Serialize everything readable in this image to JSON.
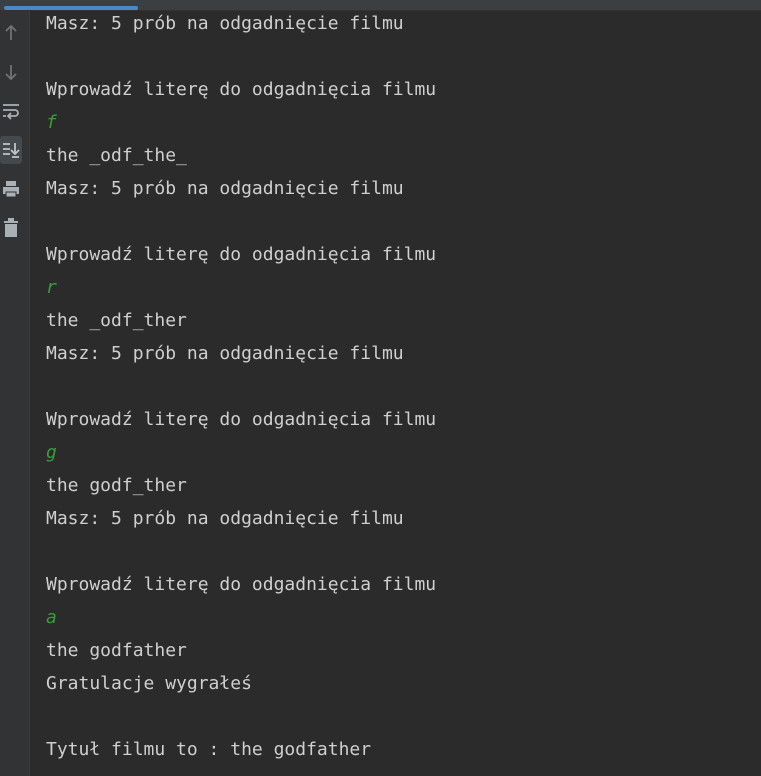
{
  "toolbar": {
    "items": [
      {
        "icon": "arrow-up-icon"
      },
      {
        "icon": "arrow-down-icon"
      },
      {
        "icon": "soft-wrap-icon"
      },
      {
        "icon": "scroll-to-end-icon",
        "active": true
      },
      {
        "icon": "print-icon"
      },
      {
        "icon": "trash-icon"
      }
    ]
  },
  "console": {
    "lines": [
      {
        "text": "Masz: 5 prób na odgadnięcie filmu",
        "type": "output"
      },
      {
        "text": "",
        "type": "output"
      },
      {
        "text": "Wprowadź literę do odgadnięcia filmu",
        "type": "output"
      },
      {
        "text": "f",
        "type": "input"
      },
      {
        "text": "the _odf_the_",
        "type": "output"
      },
      {
        "text": "Masz: 5 prób na odgadnięcie filmu",
        "type": "output"
      },
      {
        "text": "",
        "type": "output"
      },
      {
        "text": "Wprowadź literę do odgadnięcia filmu",
        "type": "output"
      },
      {
        "text": "r",
        "type": "input"
      },
      {
        "text": "the _odf_ther",
        "type": "output"
      },
      {
        "text": "Masz: 5 prób na odgadnięcie filmu",
        "type": "output"
      },
      {
        "text": "",
        "type": "output"
      },
      {
        "text": "Wprowadź literę do odgadnięcia filmu",
        "type": "output"
      },
      {
        "text": "g",
        "type": "input"
      },
      {
        "text": "the godf_ther",
        "type": "output"
      },
      {
        "text": "Masz: 5 prób na odgadnięcie filmu",
        "type": "output"
      },
      {
        "text": "",
        "type": "output"
      },
      {
        "text": "Wprowadź literę do odgadnięcia filmu",
        "type": "output"
      },
      {
        "text": "a",
        "type": "input"
      },
      {
        "text": "the godfather",
        "type": "output"
      },
      {
        "text": "Gratulacje wygrałeś",
        "type": "output"
      },
      {
        "text": "",
        "type": "output"
      },
      {
        "text": "Tytuł filmu to : the godfather",
        "type": "output"
      }
    ]
  },
  "colors": {
    "background": "#2b2b2b",
    "gutter": "#313335",
    "output_text": "#cfcfcf",
    "input_text": "#3d9a3d",
    "accent": "#4a88c7"
  }
}
